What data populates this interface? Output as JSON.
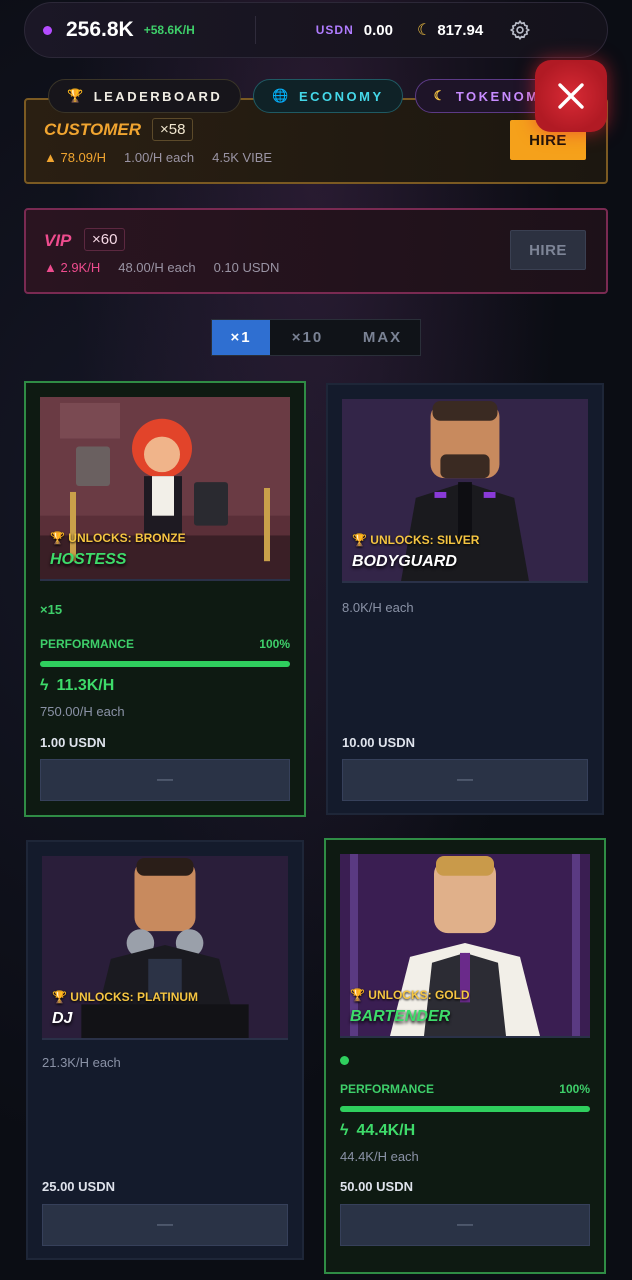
{
  "topbar": {
    "balance": "256.8K",
    "balance_rate": "+58.6K/H",
    "usdn_label": "USDN",
    "usdn_value": "0.00",
    "moon_value": "817.94",
    "gear_icon": "gear-icon",
    "moon_icon": "moon-icon"
  },
  "tabs": [
    {
      "label": "LEADERBOARD",
      "icon": "trophy-icon"
    },
    {
      "label": "ECONOMY",
      "icon": "globe-icon"
    },
    {
      "label": "TOKENOMICS",
      "icon": "moon-icon"
    }
  ],
  "recruits": {
    "customer": {
      "name": "CUSTOMER",
      "count": "×58",
      "rate": "▲ 78.09/H",
      "each": "1.00/H each",
      "cost": "4.5K VIBE",
      "hire": "HIRE"
    },
    "vip": {
      "name": "VIP",
      "count": "×60",
      "rate": "▲ 2.9K/H",
      "each": "48.00/H each",
      "cost": "0.10 USDN",
      "hire": "HIRE"
    }
  },
  "multiplier": {
    "options": [
      "×1",
      "×10",
      "MAX"
    ],
    "selected": "×1"
  },
  "staff": [
    {
      "name": "HOSTESS",
      "unlock": "🏆 UNLOCKS: BRONZE",
      "count": "×15",
      "performance_label": "PERFORMANCE",
      "performance": "100%",
      "performance_value": 1.0,
      "rate": "11.3K/H",
      "each": "750.00/H each",
      "price": "1.00 USDN",
      "action": "—"
    },
    {
      "name": "BODYGUARD",
      "unlock": "🏆 UNLOCKS: SILVER",
      "each": "8.0K/H each",
      "price": "10.00 USDN",
      "action": "—"
    },
    {
      "name": "DJ",
      "unlock": "🏆 UNLOCKS: PLATINUM",
      "each": "21.3K/H each",
      "price": "25.00 USDN",
      "action": "—"
    },
    {
      "name": "BARTENDER",
      "unlock": "🏆 UNLOCKS: GOLD",
      "performance_label": "PERFORMANCE",
      "performance": "100%",
      "performance_value": 1.0,
      "rate": "44.4K/H",
      "each": "44.4K/H each",
      "price": "50.00 USDN",
      "action": "—"
    }
  ],
  "colors": {
    "accent_green": "#3edb6a",
    "accent_orange": "#f5a11b",
    "accent_pink": "#ee4c8e",
    "close_red": "#d82a35"
  }
}
